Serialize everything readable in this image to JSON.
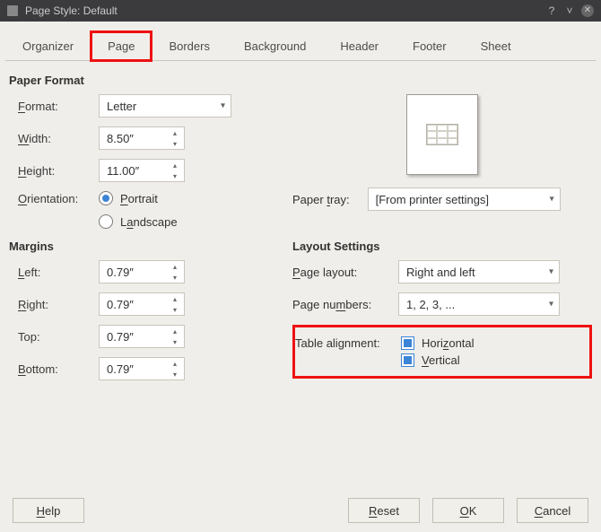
{
  "titlebar": {
    "title": "Page Style: Default"
  },
  "tabs": {
    "organizer": "Organizer",
    "page": "Page",
    "borders": "Borders",
    "background": "Background",
    "header": "Header",
    "footer": "Footer",
    "sheet": "Sheet"
  },
  "paper": {
    "section": "Paper Format",
    "format_label": "Format:",
    "format_value": "Letter",
    "width_label": "Width:",
    "width_value": "8.50″",
    "height_label": "Height:",
    "height_value": "11.00″",
    "orientation_label": "Orientation:",
    "portrait": "Portrait",
    "landscape": "Landscape",
    "tray_label": "Paper tray:",
    "tray_value": "[From printer settings]"
  },
  "margins": {
    "section": "Margins",
    "left_label": "Left:",
    "left_value": "0.79″",
    "right_label": "Right:",
    "right_value": "0.79″",
    "top_label": "Top:",
    "top_value": "0.79″",
    "bottom_label": "Bottom:",
    "bottom_value": "0.79″"
  },
  "layout": {
    "section": "Layout Settings",
    "page_layout_label": "Page layout:",
    "page_layout_value": "Right and left",
    "page_numbers_label": "Page numbers:",
    "page_numbers_value": "1, 2, 3, ...",
    "table_align_label": "Table alignment:",
    "horizontal": "Horizontal",
    "vertical": "Vertical"
  },
  "buttons": {
    "help": "Help",
    "reset": "Reset",
    "ok": "OK",
    "cancel": "Cancel"
  }
}
